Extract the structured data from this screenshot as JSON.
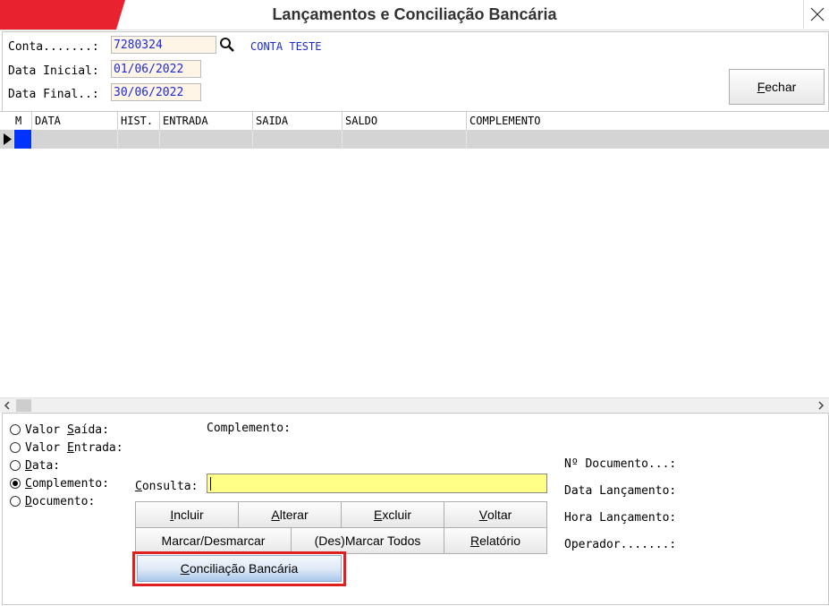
{
  "window": {
    "title": "Lançamentos e Conciliação Bancária",
    "accent_color": "#e8232f",
    "close_icon": "close-icon"
  },
  "header": {
    "conta_label": "Conta.......:",
    "conta_value": "7280324",
    "conta_name": "CONTA TESTE",
    "search_icon": "search-icon",
    "data_inicial_label": "Data Inicial:",
    "data_inicial_value": "01/06/2022",
    "data_final_label": "Data Final..:",
    "data_final_value": "30/06/2022",
    "fechar_first": "F",
    "fechar_rest": "echar"
  },
  "grid": {
    "columns": [
      "M",
      "DATA",
      "HIST.",
      "ENTRADA",
      "SAIDA",
      "SALDO",
      "COMPLEMENTO"
    ],
    "rows": [],
    "selection_color": "#0033ff"
  },
  "filters": {
    "options": [
      {
        "pre": "Valor ",
        "u": "S",
        "post": "aída:",
        "checked": false
      },
      {
        "pre": "Valor ",
        "u": "E",
        "post": "ntrada:",
        "checked": false
      },
      {
        "pre": "",
        "u": "D",
        "post": "ata:",
        "checked": false
      },
      {
        "pre": "",
        "u": "C",
        "post": "omplemento:",
        "checked": true
      },
      {
        "pre": "",
        "u": "D",
        "post": "ocumento:",
        "checked": false
      }
    ],
    "complemento_label": "Complemento:",
    "consulta_u": "C",
    "consulta_rest": "onsulta:",
    "consulta_value": ""
  },
  "actions": {
    "incluir": {
      "u": "I",
      "rest": "ncluir"
    },
    "alterar": {
      "u": "A",
      "rest": "lterar"
    },
    "excluir": {
      "u": "E",
      "rest": "xcluir"
    },
    "voltar": {
      "u": "V",
      "rest": "oltar"
    },
    "marcar_desmarcar": "Marcar/Desmarcar",
    "des_marcar_todos": "(Des)Marcar Todos",
    "relatorio": {
      "u": "R",
      "rest": "elatório"
    },
    "conciliacao": {
      "u": "C",
      "rest": "onciliação Bancária"
    }
  },
  "info": {
    "documento": "Nº Documento...:",
    "data_lancamento": "Data Lançamento:",
    "hora_lancamento": "Hora Lançamento:",
    "operador": "Operador.......:"
  }
}
